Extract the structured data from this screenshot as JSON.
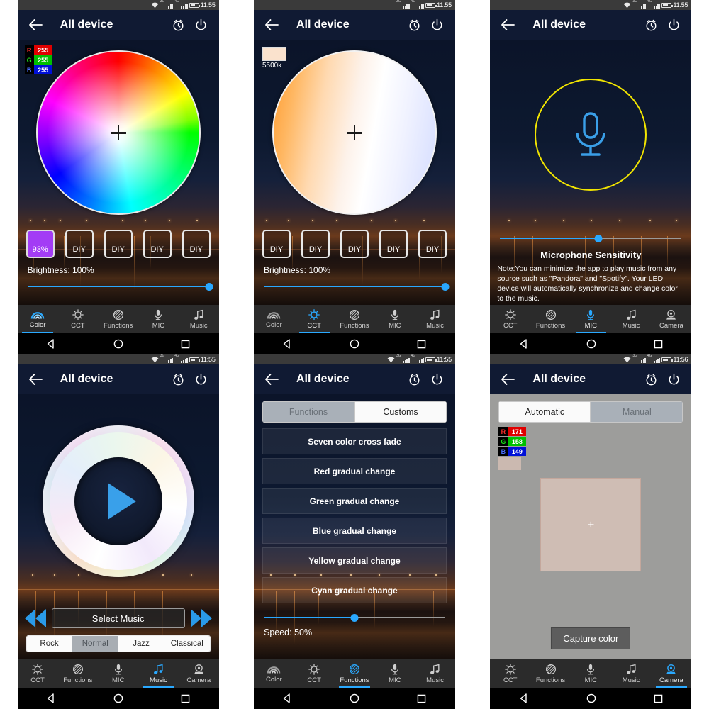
{
  "app": {
    "title": "All device",
    "icons": {
      "back": "back-arrow-icon",
      "alarm": "alarm-clock-icon",
      "power": "power-icon"
    }
  },
  "status_bar": {
    "time_1155": "11:55",
    "time_1156": "11:56"
  },
  "nav_bar": {
    "back": "triangle-back-icon",
    "home": "circle-home-icon",
    "recents": "square-recents-icon"
  },
  "tabs": {
    "color": "Color",
    "cct": "CCT",
    "functions": "Functions",
    "mic": "MIC",
    "music": "Music",
    "camera": "Camera"
  },
  "panel_color": {
    "rgb": {
      "r_key": "R",
      "r_val": "255",
      "g_key": "G",
      "g_val": "255",
      "b_key": "B",
      "b_val": "255"
    },
    "presets": [
      {
        "label": "93%",
        "active": true,
        "color": "#a33cf5"
      },
      {
        "label": "DIY",
        "active": false
      },
      {
        "label": "DIY",
        "active": false
      },
      {
        "label": "DIY",
        "active": false
      },
      {
        "label": "DIY",
        "active": false
      }
    ],
    "brightness_label": "Brightness: 100%",
    "brightness_pct": 100,
    "active_tab": "Color"
  },
  "panel_cct": {
    "swatch_label": "5500k",
    "swatch_color": "#fae2cd",
    "presets": [
      {
        "label": "DIY"
      },
      {
        "label": "DIY"
      },
      {
        "label": "DIY"
      },
      {
        "label": "DIY"
      },
      {
        "label": "DIY"
      }
    ],
    "brightness_label": "Brightness: 100%",
    "brightness_pct": 100,
    "active_tab": "CCT"
  },
  "panel_mic": {
    "sensitivity_pct": 54,
    "title": "Microphone Sensitivity",
    "note": "Note:You can minimize the app to play music from any source such as \"Pandora\" and \"Spotify\". Your LED device will automatically synchronize and change color to the music.",
    "ring_color": "#f2e500",
    "mic_color": "#3a9fe8",
    "active_tab": "MIC"
  },
  "panel_music": {
    "select_music_label": "Select Music",
    "prev_icon": "rewind-icon",
    "next_icon": "fast-forward-icon",
    "play_icon": "play-icon",
    "genres": [
      {
        "label": "Rock",
        "active": false
      },
      {
        "label": "Normal",
        "active": true
      },
      {
        "label": "Jazz",
        "active": false
      },
      {
        "label": "Classical",
        "active": false
      }
    ],
    "active_tab": "Music"
  },
  "panel_functions": {
    "segments": [
      {
        "label": "Functions",
        "active": false
      },
      {
        "label": "Customs",
        "active": true
      }
    ],
    "items": [
      "Seven color cross fade",
      "Red gradual change",
      "Green gradual change",
      "Blue gradual change",
      "Yellow gradual change",
      "Cyan gradual change"
    ],
    "speed_label": "Speed: 50%",
    "speed_pct": 50,
    "active_tab": "Functions"
  },
  "panel_camera": {
    "segments": [
      {
        "label": "Automatic",
        "active": true
      },
      {
        "label": "Manual",
        "active": false
      }
    ],
    "rgb": {
      "r_key": "R",
      "r_val": "171",
      "g_key": "G",
      "g_val": "158",
      "b_key": "B",
      "b_val": "149"
    },
    "preview_color": "#cfbdb4",
    "capture_label": "Capture color",
    "crosshair": "+",
    "active_tab": "Camera"
  }
}
